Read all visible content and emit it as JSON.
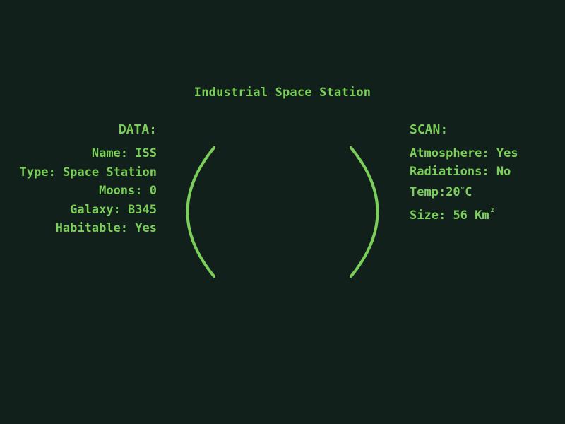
{
  "title": "Industrial Space Station",
  "data_panel": {
    "heading": "DATA:",
    "rows": [
      {
        "label": "Name:",
        "value": "ISS"
      },
      {
        "label": "Type:",
        "value": "Space Station"
      },
      {
        "label": "Moons:",
        "value": "0"
      },
      {
        "label": "Galaxy:",
        "value": "B345"
      },
      {
        "label": "Habitable:",
        "value": "Yes"
      }
    ]
  },
  "scan_panel": {
    "heading": "SCAN:",
    "atmosphere": {
      "label": "Atmosphere:",
      "value": "Yes"
    },
    "radiations": {
      "label": "Radiations:",
      "value": "No"
    },
    "temp": {
      "label": "Temp:",
      "value": "20",
      "degree": "°",
      "unit": "C"
    },
    "size": {
      "label": "Size:",
      "value": "56 Km",
      "exponent": "2"
    }
  },
  "colors": {
    "background": "#11201a",
    "accent": "#7ccf5a"
  }
}
